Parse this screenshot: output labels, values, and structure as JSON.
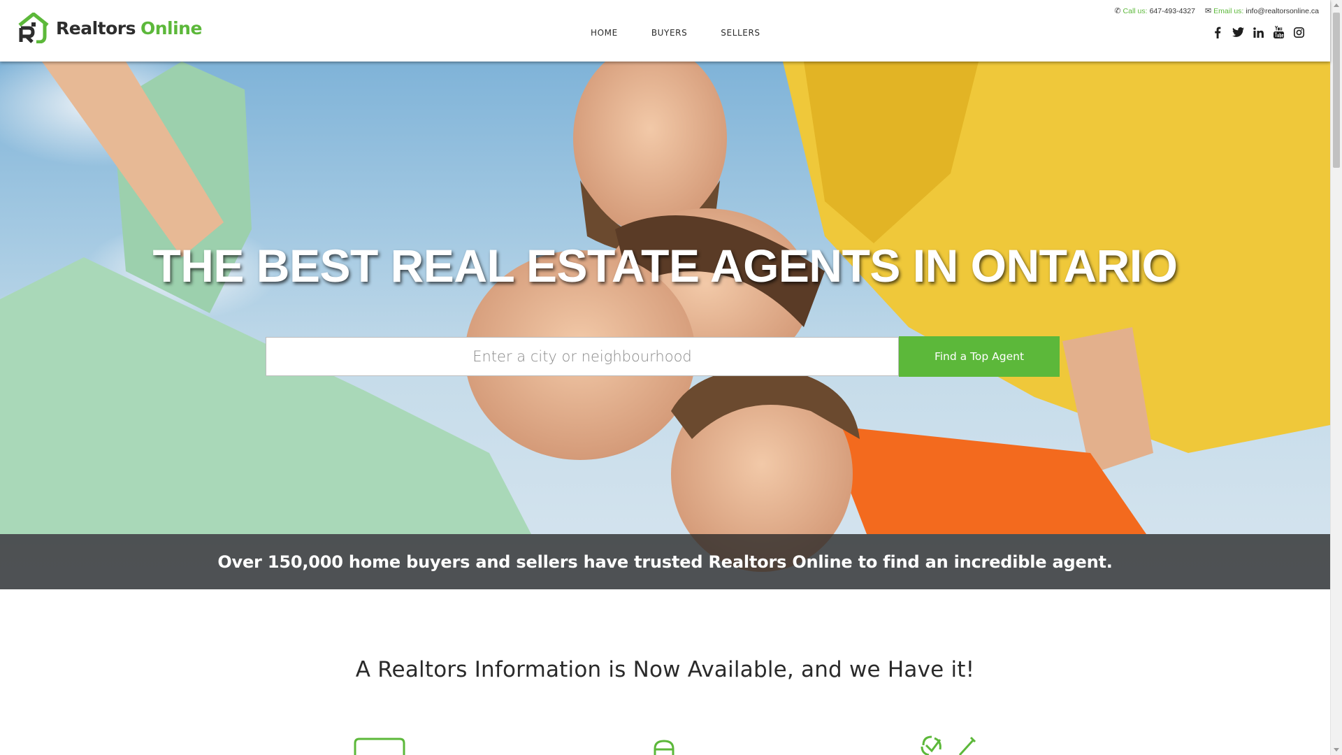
{
  "brand": {
    "name_part1": "Realtors",
    "name_part2": "Online",
    "accent_color": "#5cb83a",
    "logo_icon": "house-r-logo-icon"
  },
  "nav": {
    "items": [
      {
        "label": "HOME"
      },
      {
        "label": "BUYERS"
      },
      {
        "label": "SELLERS"
      }
    ]
  },
  "contact": {
    "phone_label": "Call us:",
    "phone_value": "647-493-4327",
    "email_label": "Email us:",
    "email_value": "info@realtorsonline.ca"
  },
  "social": [
    {
      "icon": "facebook-icon"
    },
    {
      "icon": "twitter-icon"
    },
    {
      "icon": "linkedin-icon"
    },
    {
      "icon": "youtube-icon"
    },
    {
      "icon": "instagram-icon"
    }
  ],
  "hero": {
    "title": "THE BEST REAL ESTATE AGENTS IN ONTARIO",
    "search_placeholder": "Enter a city or neighbourhood",
    "search_value": "",
    "button_label": "Find a Top Agent",
    "trust_text": "Over 150,000 home buyers and sellers have trusted Realtors Online to find an incredible agent."
  },
  "section": {
    "title": "A Realtors Information is Now Available, and we Have it!"
  }
}
